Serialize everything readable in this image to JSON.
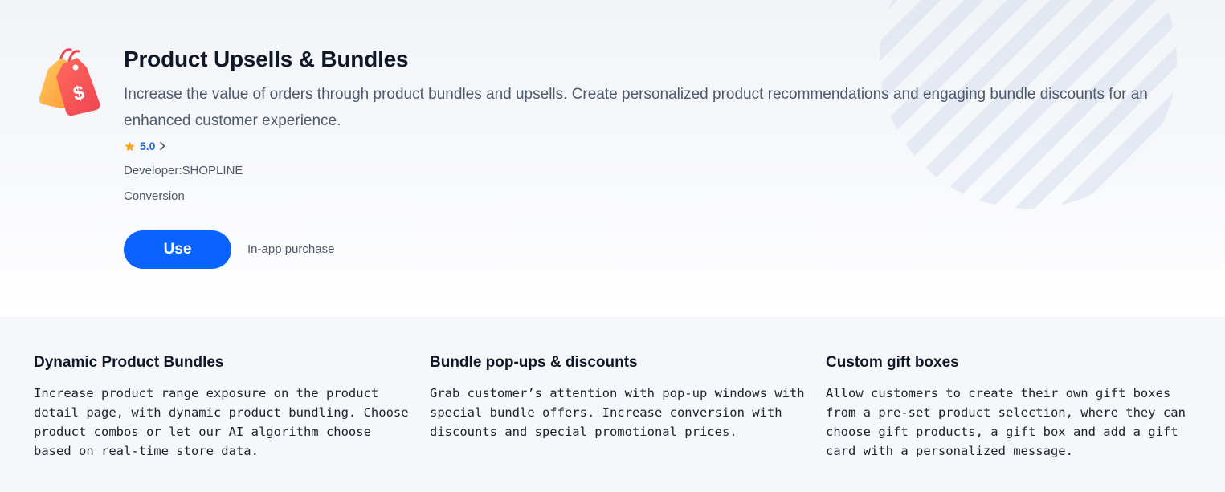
{
  "app": {
    "title": "Product Upsells & Bundles",
    "description": "Increase the value of orders through product bundles and upsells. Create personalized product recommendations and engaging bundle discounts for an enhanced customer experience.",
    "icon": "price-tag-dollar-icon",
    "rating": "5.0",
    "developer_label": "Developer:",
    "developer_name": "SHOPLINE",
    "category": "Conversion",
    "use_label": "Use",
    "pricing": "In-app purchase"
  },
  "features": [
    {
      "title": "Dynamic Product Bundles",
      "text": "Increase product range exposure on the product detail page, with dynamic product bundling. Choose product combos or let our AI algorithm choose based on real-time store data."
    },
    {
      "title": "Bundle pop-ups & discounts",
      "text": "Grab customer’s attention with pop-up windows with special bundle offers. Increase conversion with discounts and special promotional prices."
    },
    {
      "title": "Custom gift boxes",
      "text": "Allow customers to create their own gift boxes from a pre-set product selection, where they can choose gift products, a gift box and add a gift card with a personalized message."
    }
  ],
  "colors": {
    "accent": "#0a63ff",
    "rating_text": "#1f6ed6",
    "star": "#f5a623",
    "icon_red": "#f2545b",
    "icon_orange": "#ffb347"
  }
}
